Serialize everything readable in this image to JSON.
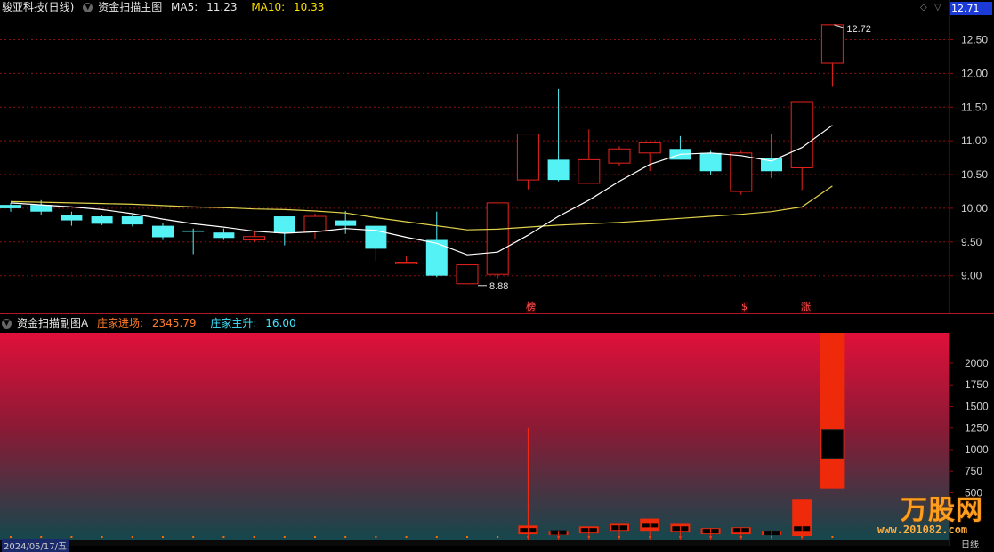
{
  "header": {
    "stock_name": "骏亚科技(日线)",
    "indicator": "资金扫描主图",
    "ma5_label": "MA5:",
    "ma5_value": "11.23",
    "ma10_label": "MA10:",
    "ma10_value": "10.33"
  },
  "price_badge": "12.71",
  "sub_header": {
    "indicator": "资金扫描副图A",
    "inflow_label": "庄家进场:",
    "inflow_value": "2345.79",
    "rise_label": "庄家主升:",
    "rise_value": "16.00"
  },
  "annotations": {
    "high_label": "12.72",
    "low_label": "8.88"
  },
  "markers": {
    "m1": "榜",
    "m2": "$",
    "m3": "涨"
  },
  "footer": {
    "date": "2024/05/17/五",
    "period": "日线"
  },
  "watermark": {
    "text": "万股网",
    "url": "www.201082.com"
  },
  "colors": {
    "up": "#e8231c",
    "down": "#54f1f5",
    "ma5": "#ffffff",
    "ma10": "#e0d24a",
    "grid": "#8a1010"
  },
  "chart_data": [
    {
      "type": "candlestick",
      "title": "资金扫描主图",
      "ylim": [
        8.6,
        12.85
      ],
      "yticks": [
        "12.50",
        "12.00",
        "11.50",
        "11.00",
        "10.50",
        "10.00",
        "9.50",
        "9.00"
      ],
      "candles": [
        {
          "o": 10.05,
          "c": 10.0,
          "h": 10.08,
          "l": 9.95
        },
        {
          "o": 10.05,
          "c": 9.95,
          "h": 10.12,
          "l": 9.9
        },
        {
          "o": 9.9,
          "c": 9.82,
          "h": 9.95,
          "l": 9.74
        },
        {
          "o": 9.88,
          "c": 9.77,
          "h": 9.9,
          "l": 9.75
        },
        {
          "o": 9.88,
          "c": 9.76,
          "h": 9.9,
          "l": 9.73
        },
        {
          "o": 9.74,
          "c": 9.57,
          "h": 9.78,
          "l": 9.53
        },
        {
          "o": 9.67,
          "c": 9.66,
          "h": 9.7,
          "l": 9.32
        },
        {
          "o": 9.64,
          "c": 9.56,
          "h": 9.7,
          "l": 9.53
        },
        {
          "o": 9.53,
          "c": 9.58,
          "h": 9.67,
          "l": 9.5
        },
        {
          "o": 9.88,
          "c": 9.63,
          "h": 9.88,
          "l": 9.45
        },
        {
          "o": 9.66,
          "c": 9.88,
          "h": 9.92,
          "l": 9.55
        },
        {
          "o": 9.82,
          "c": 9.74,
          "h": 9.96,
          "l": 9.62
        },
        {
          "o": 9.74,
          "c": 9.4,
          "h": 9.74,
          "l": 9.22
        },
        {
          "o": 9.2,
          "c": 9.2,
          "h": 9.3,
          "l": 9.18
        },
        {
          "o": 9.53,
          "c": 9.0,
          "h": 9.95,
          "l": 8.98
        },
        {
          "o": 8.88,
          "c": 9.16,
          "h": 9.16,
          "l": 8.88
        },
        {
          "o": 9.02,
          "c": 10.08,
          "h": 10.08,
          "l": 8.96
        },
        {
          "o": 10.42,
          "c": 11.1,
          "h": 11.1,
          "l": 10.28
        },
        {
          "o": 10.72,
          "c": 10.42,
          "h": 11.77,
          "l": 10.4
        },
        {
          "o": 10.37,
          "c": 10.72,
          "h": 11.17,
          "l": 10.37
        },
        {
          "o": 10.67,
          "c": 10.88,
          "h": 10.92,
          "l": 10.62
        },
        {
          "o": 10.82,
          "c": 10.97,
          "h": 10.97,
          "l": 10.55
        },
        {
          "o": 10.88,
          "c": 10.72,
          "h": 11.07,
          "l": 10.72
        },
        {
          "o": 10.82,
          "c": 10.55,
          "h": 10.85,
          "l": 10.5
        },
        {
          "o": 10.25,
          "c": 10.82,
          "h": 10.85,
          "l": 10.2
        },
        {
          "o": 10.75,
          "c": 10.55,
          "h": 11.1,
          "l": 10.45
        },
        {
          "o": 10.6,
          "c": 11.57,
          "h": 11.57,
          "l": 10.27
        },
        {
          "o": 12.15,
          "c": 12.72,
          "h": 12.72,
          "l": 11.8
        }
      ],
      "ma5": [
        10.08,
        10.05,
        10.02,
        9.98,
        9.92,
        9.84,
        9.77,
        9.72,
        9.66,
        9.63,
        9.65,
        9.7,
        9.67,
        9.57,
        9.48,
        9.31,
        9.35,
        9.6,
        9.88,
        10.12,
        10.4,
        10.65,
        10.8,
        10.82,
        10.78,
        10.7,
        10.9,
        11.23
      ],
      "ma10": [
        10.1,
        10.09,
        10.08,
        10.07,
        10.06,
        10.04,
        10.02,
        10.01,
        9.99,
        9.98,
        9.96,
        9.93,
        9.86,
        9.8,
        9.74,
        9.68,
        9.69,
        9.72,
        9.75,
        9.77,
        9.79,
        9.82,
        9.85,
        9.88,
        9.91,
        9.95,
        10.02,
        10.33
      ]
    },
    {
      "type": "bar",
      "title": "资金扫描副图A",
      "ylim": [
        0,
        2350
      ],
      "yticks": [
        "2000",
        "1750",
        "1500",
        "1250",
        "1000",
        "750",
        "500"
      ],
      "series": [
        {
          "name": "庄家进场",
          "values": [
            0,
            0,
            0,
            0,
            0,
            0,
            0,
            0,
            0,
            0,
            0,
            0,
            0,
            0,
            0,
            0,
            0,
            60,
            60,
            60,
            60,
            60,
            60,
            60,
            60,
            60,
            60,
            2345.79
          ]
        }
      ],
      "boxes": [
        {
          "i": 17,
          "top": 120,
          "bot": 20,
          "mid": 60,
          "whisker": 1250
        },
        {
          "i": 18,
          "top": 60,
          "bot": 10,
          "mid": 35
        },
        {
          "i": 19,
          "top": 110,
          "bot": 30,
          "mid": 60
        },
        {
          "i": 20,
          "top": 150,
          "bot": 60,
          "mid": 90
        },
        {
          "i": 21,
          "top": 200,
          "bot": 60,
          "mid": 120
        },
        {
          "i": 22,
          "top": 150,
          "bot": 50,
          "mid": 80
        },
        {
          "i": 23,
          "top": 90,
          "bot": 20,
          "mid": 50
        },
        {
          "i": 24,
          "top": 100,
          "bot": 20,
          "mid": 60
        },
        {
          "i": 25,
          "top": 60,
          "bot": 10,
          "mid": 30
        },
        {
          "i": 26,
          "top": 420,
          "bot": 0,
          "mid": 80
        },
        {
          "i": 27,
          "top": 2350,
          "bot": 550,
          "mid": 900
        }
      ]
    }
  ]
}
